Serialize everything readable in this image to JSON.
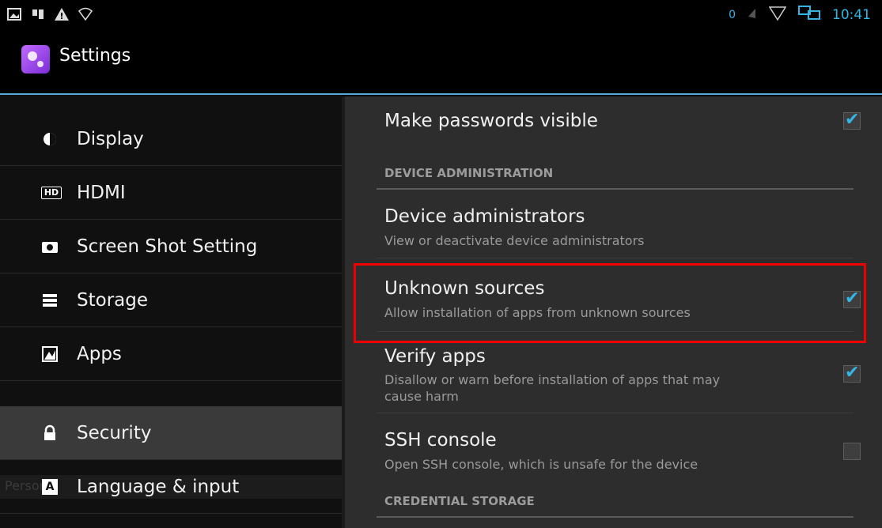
{
  "statusbar": {
    "notification_count": "0",
    "time": "10:41",
    "icons": [
      "image-icon",
      "usb-debug-icon",
      "warning-icon",
      "wifi-icon",
      "mute-icon",
      "signal-icon",
      "network-icon"
    ]
  },
  "actionbar": {
    "title": "Settings",
    "icon": "settings-app-icon"
  },
  "sidebar": {
    "items": [
      {
        "label": "Display",
        "icon": "display-icon"
      },
      {
        "label": "HDMI",
        "icon": "hdmi-icon",
        "icon_text": "HD"
      },
      {
        "label": "Screen Shot Setting",
        "icon": "camera-icon"
      },
      {
        "label": "Storage",
        "icon": "storage-icon"
      },
      {
        "label": "Apps",
        "icon": "apps-icon"
      }
    ],
    "section_personal": "Personal",
    "items_personal": [
      {
        "label": "Security",
        "icon": "lock-icon",
        "selected": true
      },
      {
        "label": "Language & input",
        "icon": "language-icon",
        "icon_text": "A"
      }
    ]
  },
  "main": {
    "make_passwords_visible": {
      "title": "Make passwords visible",
      "checked": true
    },
    "device_admin_header": "DEVICE ADMINISTRATION",
    "device_administrators": {
      "title": "Device administrators",
      "subtitle": "View or deactivate device administrators"
    },
    "unknown_sources": {
      "title": "Unknown sources",
      "subtitle": "Allow installation of apps from unknown sources",
      "checked": true
    },
    "verify_apps": {
      "title": "Verify apps",
      "subtitle": "Disallow or warn before installation of apps that may cause harm",
      "checked": true
    },
    "ssh_console": {
      "title": "SSH console",
      "subtitle": "Open SSH console, which is unsafe for the device",
      "checked": false
    },
    "credential_storage_header": "CREDENTIAL STORAGE"
  },
  "colors": {
    "accent": "#33b5e5",
    "highlight": "#dd0000"
  }
}
